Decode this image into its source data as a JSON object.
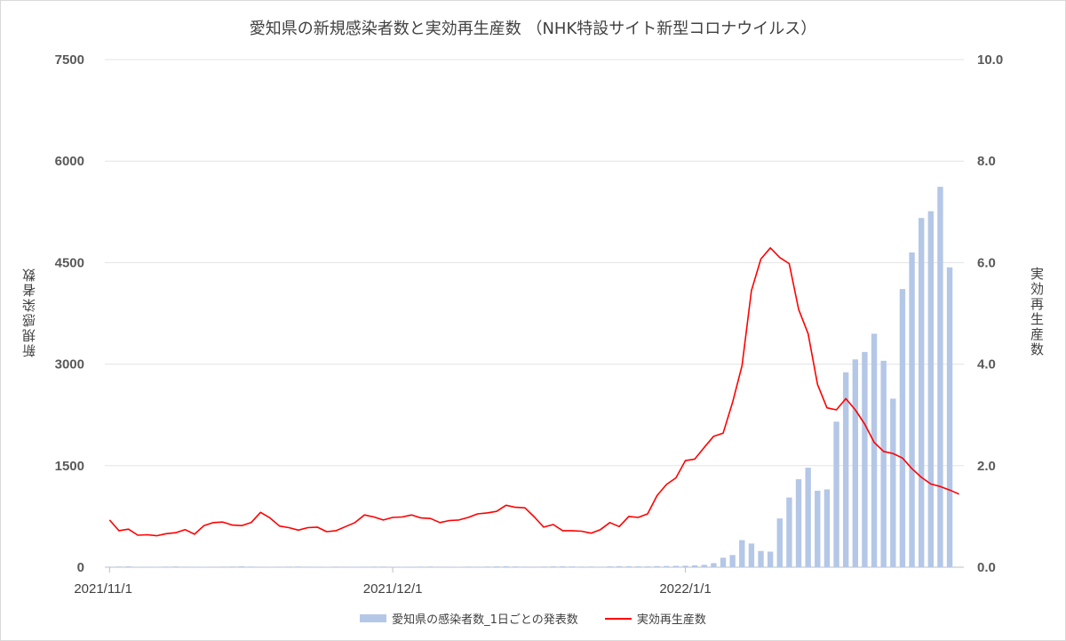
{
  "chart_data": {
    "type": "bar+line",
    "title": "愛知県の新規感染者数と実効再生産数 （NHK特設サイト新型コロナウイルス）",
    "ylabel_left": "新規感染者数",
    "ylabel_right": "実効再生産数",
    "ylim_left": [
      0,
      7500
    ],
    "ylim_right": [
      0,
      10.0
    ],
    "yticks_left": [
      "0",
      "1500",
      "3000",
      "4500",
      "6000",
      "7500"
    ],
    "yticks_right": [
      "0.0",
      "2.0",
      "4.0",
      "6.0",
      "8.0",
      "10.0"
    ],
    "xticks": [
      {
        "label": "2021/11/1",
        "index": 0
      },
      {
        "label": "2021/12/1",
        "index": 30
      },
      {
        "label": "2022/1/1",
        "index": 61
      }
    ],
    "x_start": "2021-11-01",
    "x_end": "2022-01-31",
    "grid": "horizontal",
    "legend_position": "bottom",
    "series": [
      {
        "name": "愛知県の感染者数_1日ごとの発表数",
        "axis": "left",
        "type": "bar",
        "color": "#b4c7e7",
        "values": [
          8,
          10,
          12,
          6,
          7,
          5,
          9,
          11,
          8,
          7,
          6,
          8,
          9,
          10,
          12,
          9,
          7,
          6,
          8,
          9,
          10,
          8,
          7,
          6,
          9,
          8,
          7,
          8,
          9,
          10,
          7,
          6,
          8,
          9,
          10,
          8,
          7,
          6,
          9,
          8,
          10,
          12,
          14,
          11,
          9,
          8,
          10,
          12,
          13,
          11,
          9,
          10,
          8,
          12,
          15,
          14,
          13,
          12,
          16,
          18,
          20,
          22,
          28,
          35,
          60,
          140,
          180,
          400,
          350,
          240,
          230,
          720,
          1030,
          1300,
          1470,
          1130,
          1150,
          2150,
          2880,
          3070,
          3180,
          3450,
          3050,
          2490,
          4110,
          4650,
          5160,
          5260,
          5620,
          4430
        ]
      },
      {
        "name": "実効再生産数",
        "axis": "right",
        "type": "line",
        "color": "#ff0000",
        "values": [
          0.93,
          0.72,
          0.75,
          0.63,
          0.64,
          0.62,
          0.66,
          0.68,
          0.74,
          0.65,
          0.82,
          0.88,
          0.89,
          0.83,
          0.82,
          0.88,
          1.08,
          0.97,
          0.81,
          0.78,
          0.73,
          0.78,
          0.79,
          0.7,
          0.72,
          0.8,
          0.88,
          1.03,
          0.99,
          0.93,
          0.98,
          0.99,
          1.03,
          0.97,
          0.96,
          0.88,
          0.92,
          0.93,
          0.98,
          1.05,
          1.07,
          1.1,
          1.22,
          1.18,
          1.17,
          0.99,
          0.79,
          0.84,
          0.72,
          0.72,
          0.71,
          0.67,
          0.74,
          0.88,
          0.8,
          1.0,
          0.98,
          1.05,
          1.41,
          1.63,
          1.76,
          2.1,
          2.13,
          2.36,
          2.58,
          2.64,
          3.25,
          3.97,
          5.45,
          6.07,
          6.29,
          6.1,
          5.98,
          5.08,
          4.6,
          3.6,
          3.14,
          3.1,
          3.32,
          3.1,
          2.82,
          2.46,
          2.28,
          2.24,
          2.15,
          1.94,
          1.77,
          1.64,
          1.59,
          1.52,
          1.44
        ]
      }
    ]
  }
}
